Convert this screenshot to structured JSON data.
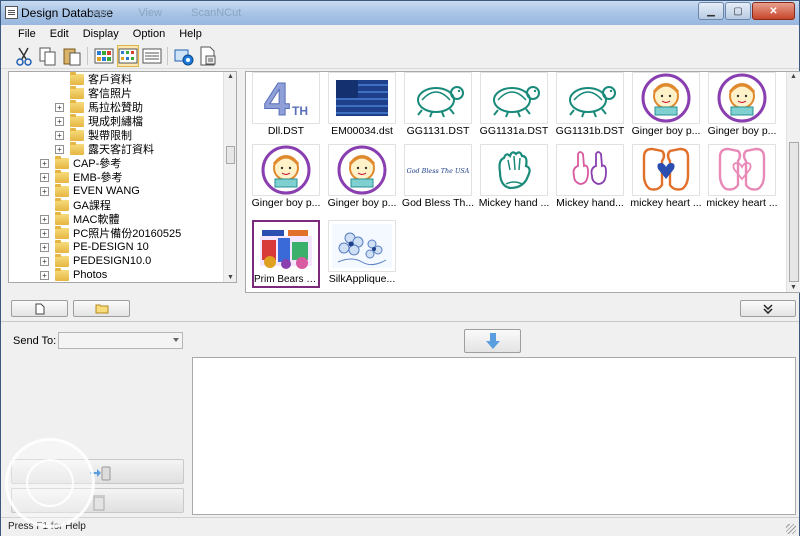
{
  "window": {
    "title": "Design Database",
    "ghost_tabs": [
      "age",
      "View",
      "ScanNCut"
    ]
  },
  "menu": [
    "File",
    "Edit",
    "Display",
    "Option",
    "Help"
  ],
  "toolbar": {
    "items": [
      "cut-icon",
      "copy-icon",
      "paste-icon",
      "large-icons-view-icon",
      "medium-icons-view-icon",
      "details-view-icon",
      "send-to-machine-icon",
      "file-properties-icon"
    ],
    "active": "medium-icons-view-icon"
  },
  "tree": {
    "rows": [
      {
        "label": "客戶資料",
        "level": 2,
        "expander": ""
      },
      {
        "label": "客信照片",
        "level": 2,
        "expander": ""
      },
      {
        "label": "馬拉松贊助",
        "level": 1,
        "expander": "+"
      },
      {
        "label": "現成刺繡檔",
        "level": 1,
        "expander": "+"
      },
      {
        "label": "製帶限制",
        "level": 1,
        "expander": "+"
      },
      {
        "label": "露天客訂資料",
        "level": 1,
        "expander": "+"
      },
      {
        "label": "CAP-參考",
        "level": 0,
        "expander": "+"
      },
      {
        "label": "EMB-參考",
        "level": 0,
        "expander": "+"
      },
      {
        "label": "EVEN WANG",
        "level": 0,
        "expander": "+"
      },
      {
        "label": "GA課程",
        "level": 0,
        "expander": ""
      },
      {
        "label": "MAC軟體",
        "level": 0,
        "expander": "+"
      },
      {
        "label": "PC照片備份20160525",
        "level": 0,
        "expander": "+"
      },
      {
        "label": "PE-DESIGN 10",
        "level": 0,
        "expander": "+"
      },
      {
        "label": "PEDESIGN10.0",
        "level": 0,
        "expander": "+"
      },
      {
        "label": "Photos",
        "level": 0,
        "expander": "+"
      }
    ]
  },
  "files": [
    {
      "label": "Dll.DST",
      "thumb": "4th"
    },
    {
      "label": "EM00034.dst",
      "thumb": "flag"
    },
    {
      "label": "GG1131.DST",
      "thumb": "turtle"
    },
    {
      "label": "GG1131a.DST",
      "thumb": "turtle"
    },
    {
      "label": "GG1131b.DST",
      "thumb": "turtle"
    },
    {
      "label": "Ginger boy p...",
      "thumb": "boy"
    },
    {
      "label": "Ginger boy p...",
      "thumb": "boy"
    },
    {
      "label": "Ginger boy p...",
      "thumb": "boy"
    },
    {
      "label": "Ginger boy p...",
      "thumb": "boy"
    },
    {
      "label": "God Bless Th...",
      "thumb": "godbless",
      "thumb_text": "God Bless The USA"
    },
    {
      "label": "Mickey hand ...",
      "thumb": "hand-teal"
    },
    {
      "label": "Mickey hand...",
      "thumb": "hand-pink"
    },
    {
      "label": "mickey heart ...",
      "thumb": "heart-orange"
    },
    {
      "label": "mickey heart ...",
      "thumb": "heart-pink"
    },
    {
      "label": "Prim Bears Fo...",
      "thumb": "bears",
      "selected": true
    },
    {
      "label": "SilkApplique...",
      "thumb": "flowers"
    }
  ],
  "send": {
    "label": "Send To:",
    "value": ""
  },
  "status": "Press F1 for Help",
  "colors": {
    "selection_border": "#7b2a7b",
    "titlebar": "#a9c4e6"
  }
}
